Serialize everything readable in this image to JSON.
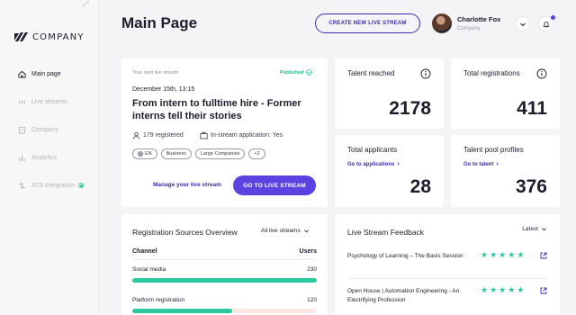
{
  "sidebar": {
    "logo_text": "COMPANY",
    "items": [
      {
        "label": "Main page",
        "active": true
      },
      {
        "label": "Live streams"
      },
      {
        "label": "Company"
      },
      {
        "label": "Analytics"
      },
      {
        "label": "ATS Integration"
      }
    ]
  },
  "header": {
    "title": "Main Page",
    "create_button": "CREATE NEW LIVE STREAM",
    "user_name": "Charlotte Fox",
    "user_company": "Company"
  },
  "next_stream": {
    "label": "Your next live stream",
    "status": "Published",
    "date": "December 15th, 13:15",
    "title": "From intern to fulltime hire - Former interns tell their stories",
    "registered": "179 registered",
    "in_stream_application": "In-stream application: Yes",
    "tags": [
      "EN",
      "Business",
      "Large Companies",
      "+2"
    ],
    "manage_link": "Manage your live stream",
    "go_button": "GO TO LIVE STREAM"
  },
  "stats": {
    "talent_reached": {
      "label": "Talent reached",
      "value": "2178"
    },
    "total_registrations": {
      "label": "Total registrations",
      "value": "411"
    },
    "total_applicants": {
      "label": "Total applicants",
      "link": "Go to applications",
      "value": "28"
    },
    "talent_pool": {
      "label": "Talent pool profiles",
      "link": "Go to talent",
      "value": "376"
    }
  },
  "sources": {
    "title": "Registration Sources Overview",
    "filter": "All live streams",
    "col_channel": "Channel",
    "col_users": "Users",
    "rows": [
      {
        "channel": "Social media",
        "users": "230",
        "fraction": 1.0
      },
      {
        "channel": "Platform registration",
        "users": "120",
        "fraction": 0.54
      }
    ]
  },
  "feedback": {
    "title": "Live Stream Feedback",
    "sort": "Latest",
    "items": [
      {
        "title": "Psychology of Learning – The Basis Session",
        "rating": 5
      },
      {
        "title": "Open House | Automation Engineering - An Electrifying Profession",
        "rating": 5
      }
    ]
  },
  "colors": {
    "accent": "#5a43e0",
    "accent_dark": "#3a2fa8",
    "success": "#2bc9a0"
  }
}
